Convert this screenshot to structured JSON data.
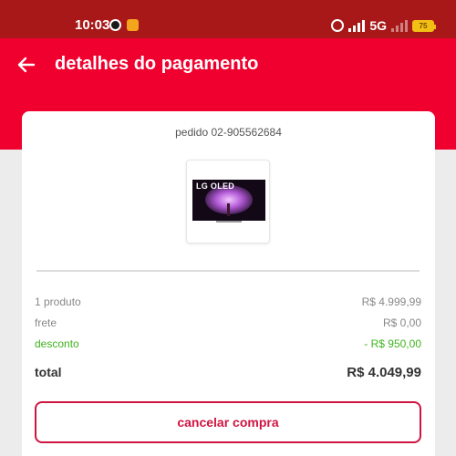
{
  "status_bar": {
    "time": "10:03",
    "network": "5G",
    "battery": "75"
  },
  "header": {
    "title": "detalhes do pagamento",
    "back_icon": "arrow-left-icon"
  },
  "order": {
    "id_label": "pedido 02-905562684",
    "product_brand_text": "LG OLED"
  },
  "summary": {
    "items_label": "1 produto",
    "items_value": "R$ 4.999,99",
    "shipping_label": "frete",
    "shipping_value": "R$ 0,00",
    "discount_label": "desconto",
    "discount_value": "- R$ 950,00",
    "total_label": "total",
    "total_value": "R$ 4.049,99"
  },
  "actions": {
    "cancel_label": "cancelar compra"
  },
  "colors": {
    "status_bar": "#a81818",
    "header": "#f0002e",
    "discount": "#3fb41f",
    "cancel_accent": "#cf1441"
  }
}
